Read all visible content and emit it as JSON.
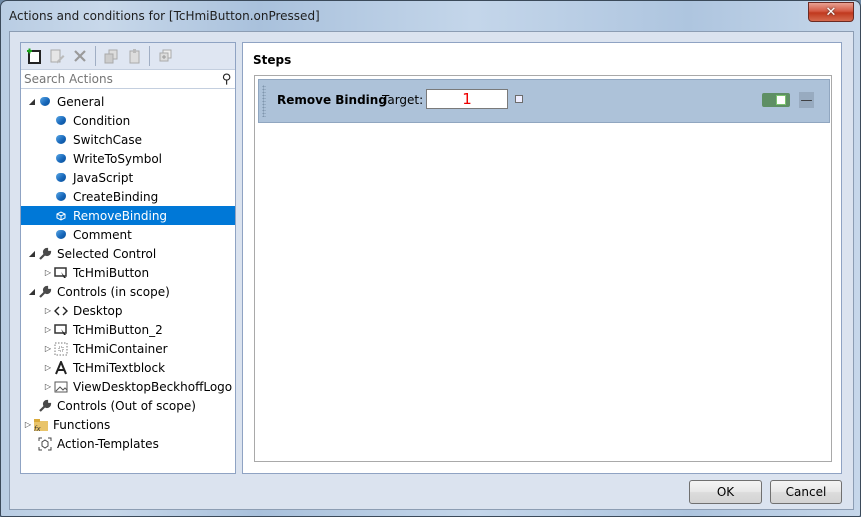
{
  "window": {
    "title": "Actions and conditions for [TcHmiButton.onPressed]",
    "close_label": "✕"
  },
  "toolbar": {
    "items": [
      {
        "icon": "add-action-icon",
        "enabled": true
      },
      {
        "icon": "edit-action-icon",
        "enabled": false
      },
      {
        "icon": "delete-action-icon",
        "enabled": false
      },
      {
        "icon": "copy-icon",
        "enabled": false
      },
      {
        "icon": "paste-icon",
        "enabled": false
      },
      {
        "icon": "duplicate-icon",
        "enabled": false
      }
    ]
  },
  "search": {
    "placeholder": "Search Actions",
    "value": ""
  },
  "tree": [
    {
      "label": "General",
      "level": 0,
      "expander": "expanded",
      "icon": "cube-icon"
    },
    {
      "label": "Condition",
      "level": 1,
      "expander": "none",
      "icon": "cube-icon"
    },
    {
      "label": "SwitchCase",
      "level": 1,
      "expander": "none",
      "icon": "cube-icon"
    },
    {
      "label": "WriteToSymbol",
      "level": 1,
      "expander": "none",
      "icon": "cube-icon"
    },
    {
      "label": "JavaScript",
      "level": 1,
      "expander": "none",
      "icon": "cube-icon"
    },
    {
      "label": "CreateBinding",
      "level": 1,
      "expander": "none",
      "icon": "cube-icon"
    },
    {
      "label": "RemoveBinding",
      "level": 1,
      "expander": "none",
      "icon": "cube-icon",
      "selected": true
    },
    {
      "label": "Comment",
      "level": 1,
      "expander": "none",
      "icon": "cube-icon"
    },
    {
      "label": "Selected Control",
      "level": 0,
      "expander": "expanded",
      "icon": "wrench-icon"
    },
    {
      "label": "TcHmiButton",
      "level": 1,
      "expander": "collapsed",
      "icon": "button-control-icon"
    },
    {
      "label": "Controls (in scope)",
      "level": 0,
      "expander": "expanded",
      "icon": "wrench-icon"
    },
    {
      "label": "Desktop",
      "level": 1,
      "expander": "collapsed",
      "icon": "code-icon"
    },
    {
      "label": "TcHmiButton_2",
      "level": 1,
      "expander": "collapsed",
      "icon": "button-control-icon"
    },
    {
      "label": "TcHmiContainer",
      "level": 1,
      "expander": "collapsed",
      "icon": "container-icon"
    },
    {
      "label": "TcHmiTextblock",
      "level": 1,
      "expander": "collapsed",
      "icon": "textblock-icon"
    },
    {
      "label": "ViewDesktopBeckhoffLogo",
      "level": 1,
      "expander": "collapsed",
      "icon": "image-icon"
    },
    {
      "label": "Controls (Out of scope)",
      "level": 0,
      "expander": "none",
      "icon": "wrench-icon"
    },
    {
      "label": "Functions",
      "level": -1,
      "expander": "collapsed",
      "icon": "functions-folder-icon"
    },
    {
      "label": "Action-Templates",
      "level": 0,
      "expander": "none",
      "icon": "template-icon"
    }
  ],
  "steps": {
    "title": "Steps",
    "items": [
      {
        "name": "Remove Binding",
        "target_label": "Target:",
        "target_value": "1",
        "enabled": true,
        "remove_label": "—"
      }
    ]
  },
  "buttons": {
    "ok": "OK",
    "cancel": "Cancel"
  },
  "colors": {
    "selection": "#0078d7",
    "step_bg": "#adc2d9",
    "toggle_on": "#5e8f64",
    "target_text": "#ee0000"
  }
}
